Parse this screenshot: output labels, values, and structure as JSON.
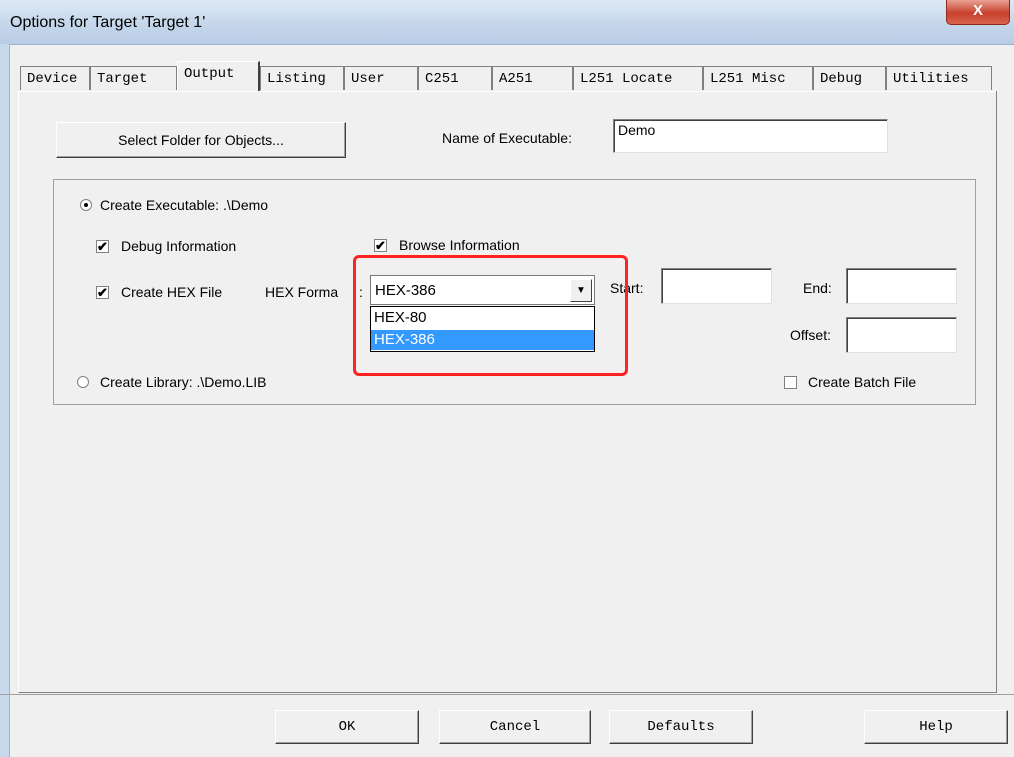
{
  "window": {
    "title": "Options for Target 'Target 1'",
    "close_glyph": "X"
  },
  "tabs": [
    {
      "label": "Device"
    },
    {
      "label": "Target"
    },
    {
      "label": "Output",
      "active": true
    },
    {
      "label": "Listing"
    },
    {
      "label": "User"
    },
    {
      "label": "C251"
    },
    {
      "label": "A251"
    },
    {
      "label": "L251 Locate"
    },
    {
      "label": "L251 Misc"
    },
    {
      "label": "Debug"
    },
    {
      "label": "Utilities"
    }
  ],
  "output": {
    "select_folder_button": "Select Folder for Objects...",
    "name_label": "Name of Executable:",
    "name_value": "Demo",
    "create_executable_label": "Create Executable: .\\Demo",
    "create_executable_selected": true,
    "debug_info_label": "Debug Information",
    "debug_info_checked": true,
    "browse_info_label": "Browse Information",
    "browse_info_checked": true,
    "create_hex_label": "Create HEX File",
    "create_hex_checked": true,
    "hex_format_label": "HEX Forma",
    "hex_format_colon": ":",
    "hex_format_value": "HEX-386",
    "hex_format_options": [
      "HEX-80",
      "HEX-386"
    ],
    "hex_format_highlighted": "HEX-386",
    "start_label": "Start:",
    "start_value": "",
    "end_label": "End:",
    "end_value": "",
    "offset_label": "Offset:",
    "offset_value": "",
    "create_library_label": "Create Library: .\\Demo.LIB",
    "create_library_selected": false,
    "create_batch_label": "Create Batch File",
    "create_batch_checked": false,
    "check_glyph": "✔"
  },
  "footer": {
    "ok": "OK",
    "cancel": "Cancel",
    "defaults": "Defaults",
    "help": "Help"
  },
  "colors": {
    "highlight_box": "#ff2222",
    "selection": "#3399ff"
  }
}
